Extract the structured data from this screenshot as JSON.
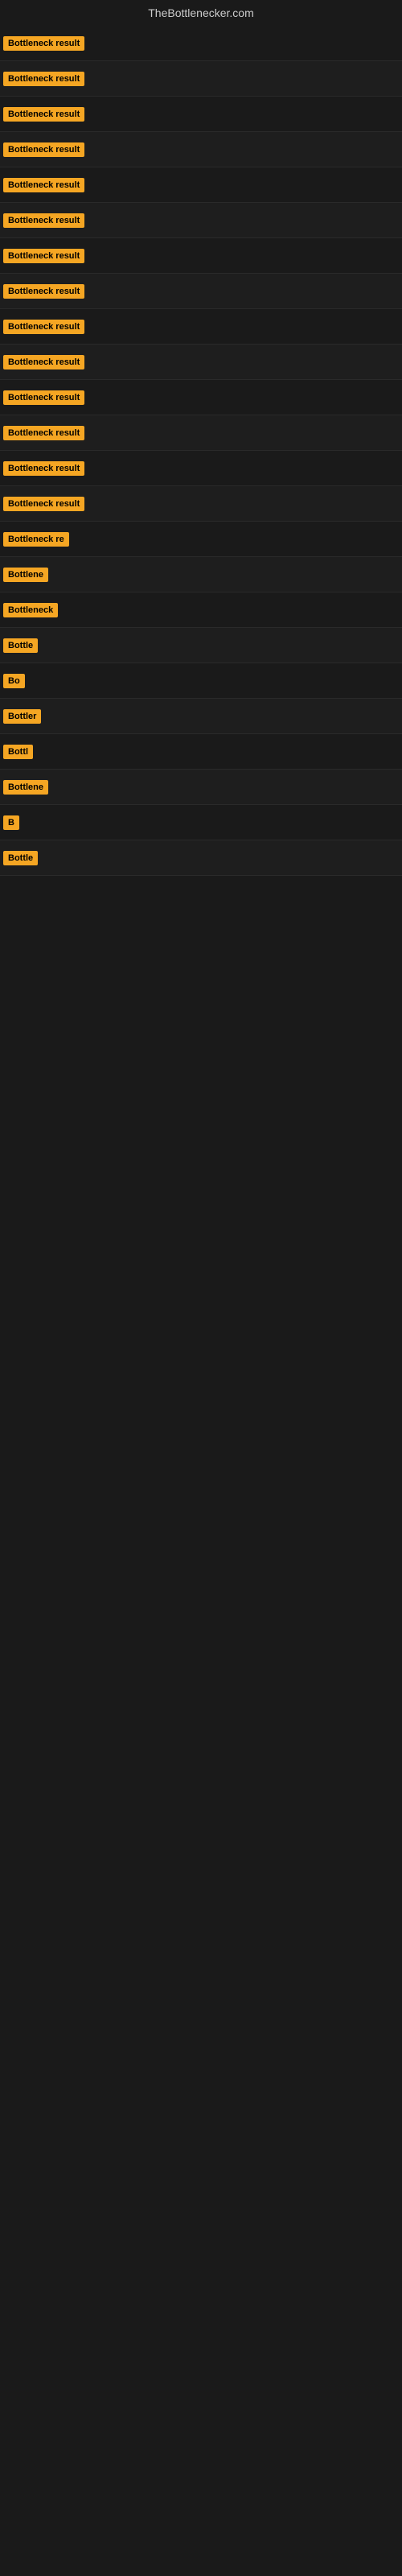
{
  "site": {
    "title": "TheBottlenecker.com"
  },
  "rows": [
    {
      "id": 1,
      "label": "Bottleneck result",
      "truncated": false
    },
    {
      "id": 2,
      "label": "Bottleneck result",
      "truncated": false
    },
    {
      "id": 3,
      "label": "Bottleneck result",
      "truncated": false
    },
    {
      "id": 4,
      "label": "Bottleneck result",
      "truncated": false
    },
    {
      "id": 5,
      "label": "Bottleneck result",
      "truncated": false
    },
    {
      "id": 6,
      "label": "Bottleneck result",
      "truncated": false
    },
    {
      "id": 7,
      "label": "Bottleneck result",
      "truncated": false
    },
    {
      "id": 8,
      "label": "Bottleneck result",
      "truncated": false
    },
    {
      "id": 9,
      "label": "Bottleneck result",
      "truncated": false
    },
    {
      "id": 10,
      "label": "Bottleneck result",
      "truncated": false
    },
    {
      "id": 11,
      "label": "Bottleneck result",
      "truncated": false
    },
    {
      "id": 12,
      "label": "Bottleneck result",
      "truncated": false
    },
    {
      "id": 13,
      "label": "Bottleneck result",
      "truncated": false
    },
    {
      "id": 14,
      "label": "Bottleneck result",
      "truncated": false
    },
    {
      "id": 15,
      "label": "Bottleneck re",
      "truncated": true
    },
    {
      "id": 16,
      "label": "Bottlene",
      "truncated": true
    },
    {
      "id": 17,
      "label": "Bottleneck",
      "truncated": true
    },
    {
      "id": 18,
      "label": "Bottle",
      "truncated": true
    },
    {
      "id": 19,
      "label": "Bo",
      "truncated": true
    },
    {
      "id": 20,
      "label": "Bottler",
      "truncated": true
    },
    {
      "id": 21,
      "label": "Bottl",
      "truncated": true
    },
    {
      "id": 22,
      "label": "Bottlene",
      "truncated": true
    },
    {
      "id": 23,
      "label": "B",
      "truncated": true
    },
    {
      "id": 24,
      "label": "Bottle",
      "truncated": true
    }
  ],
  "colors": {
    "badge_bg": "#f5a623",
    "badge_text": "#000000",
    "site_title": "#cccccc",
    "background": "#1a1a1a"
  }
}
